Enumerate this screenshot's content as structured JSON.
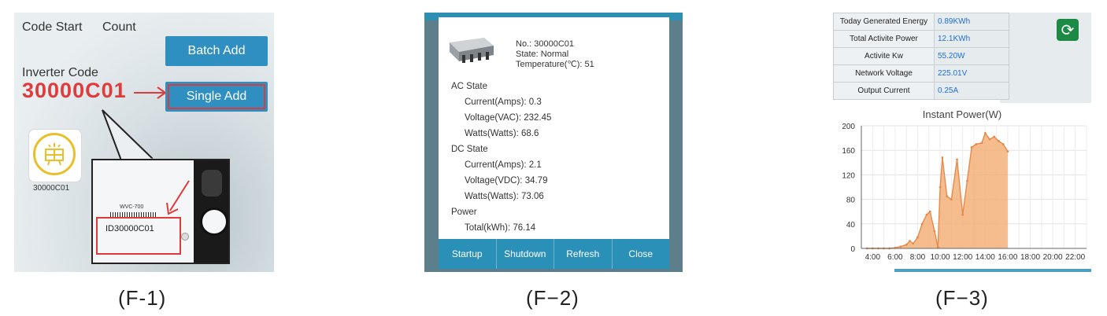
{
  "f1": {
    "code_start": "Code Start",
    "count": "Count",
    "batch_add": "Batch Add",
    "inverter_code_label": "Inverter Code",
    "inverter_code_value": "30000C01",
    "single_add": "Single Add",
    "tile_label": "30000C01",
    "nameplate_model": "WVC-700",
    "nameplate_id": "ID30000C01",
    "caption": "(F-1)"
  },
  "f2": {
    "no": "No.: 30000C01",
    "state": "State: Normal",
    "temperature": "Temperature(℃): 51",
    "ac_state": "AC State",
    "ac_current": "Current(Amps): 0.3",
    "ac_voltage": "Voltage(VAC): 232.45",
    "ac_watts": "Watts(Watts): 68.6",
    "dc_state": "DC State",
    "dc_current": "Current(Amps): 2.1",
    "dc_voltage": "Voltage(VDC): 34.79",
    "dc_watts": "Watts(Watts): 73.06",
    "power": "Power",
    "total": "Total(kWh): 76.14",
    "buttons": [
      "Startup",
      "Shutdown",
      "Refresh",
      "Close"
    ],
    "caption": "(F−2)"
  },
  "f3": {
    "rows": [
      {
        "key": "Today Generated Energy",
        "value": "0.89KWh"
      },
      {
        "key": "Total Activite Power",
        "value": "12.1KWh"
      },
      {
        "key": "Activite Kw",
        "value": "55.20W"
      },
      {
        "key": "Network Voltage",
        "value": "225.01V"
      },
      {
        "key": "Output Current",
        "value": "0.25A"
      }
    ],
    "caption": "(F−3)"
  },
  "chart_data": {
    "type": "area",
    "title": "Instant Power(W)",
    "xlabel": "",
    "ylabel": "",
    "x_ticks": [
      "4:00",
      "6:00",
      "8:00",
      "10:00",
      "12:00",
      "14:00",
      "16:00",
      "18:00",
      "20:00",
      "22:00"
    ],
    "y_ticks": [
      0,
      40,
      80,
      120,
      160,
      200
    ],
    "xlim": [
      3,
      23
    ],
    "ylim": [
      0,
      200
    ],
    "grid": true,
    "x": [
      3.5,
      4.0,
      4.5,
      5.0,
      5.5,
      6.0,
      6.5,
      7.0,
      7.3,
      7.6,
      8.0,
      8.4,
      8.8,
      9.1,
      9.5,
      9.8,
      10.0,
      10.2,
      10.6,
      11.0,
      11.5,
      12.0,
      12.4,
      12.8,
      13.2,
      13.7,
      14.0,
      14.4,
      14.8,
      15.2,
      15.6,
      16.0
    ],
    "y": [
      0,
      0,
      0,
      0,
      0,
      1,
      3,
      6,
      12,
      8,
      18,
      40,
      55,
      60,
      28,
      2,
      100,
      148,
      85,
      80,
      145,
      55,
      110,
      165,
      170,
      172,
      188,
      178,
      182,
      175,
      170,
      158
    ],
    "color": "#f3b07a"
  },
  "colors": {
    "accent_blue": "#2f8fc0",
    "highlight_red": "#e03b3b",
    "green_button": "#1c8a45",
    "value_blue": "#1f6fd1",
    "area_fill": "#f3b07a"
  }
}
